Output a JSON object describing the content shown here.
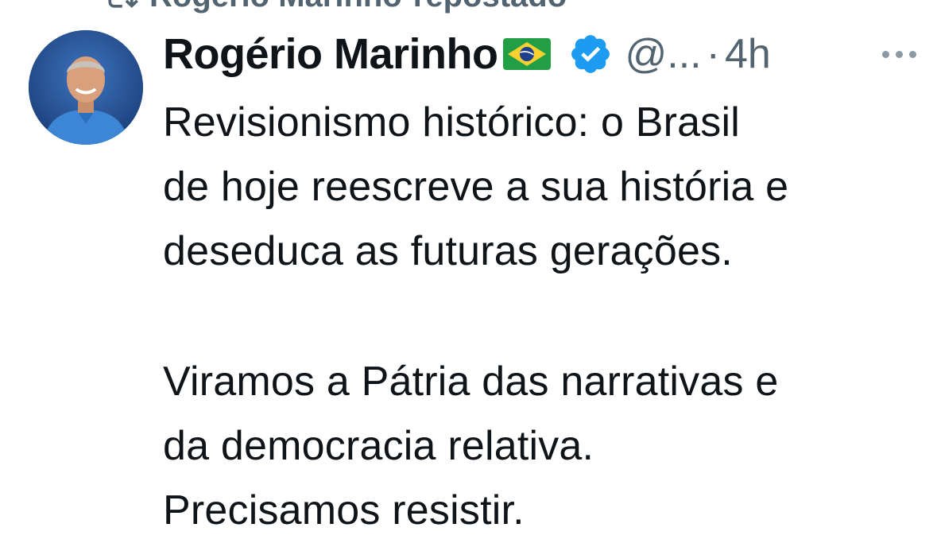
{
  "repost": {
    "text": "Rogério Marinho",
    "suffix": "repostado",
    "icon": "repost-icon"
  },
  "tweet": {
    "display_name": "Rogério Marinho",
    "flag": "brazil-flag-emoji",
    "verified_icon": "verified-badge-icon",
    "handle": "@...",
    "separator": "·",
    "time": "4h",
    "more_icon": "more-options-icon",
    "paragraph_1": "Revisionismo histórico: o Brasil\nde hoje reescreve a sua história e\ndeseduca as futuras gerações.",
    "paragraph_2": "Viramos a Pátria das narrativas e\nda democracia relativa.\nPrecisamos resistir."
  },
  "colors": {
    "text": "#0f1419",
    "secondary": "#536471",
    "verified": "#1d9bf0",
    "background": "#ffffff"
  }
}
